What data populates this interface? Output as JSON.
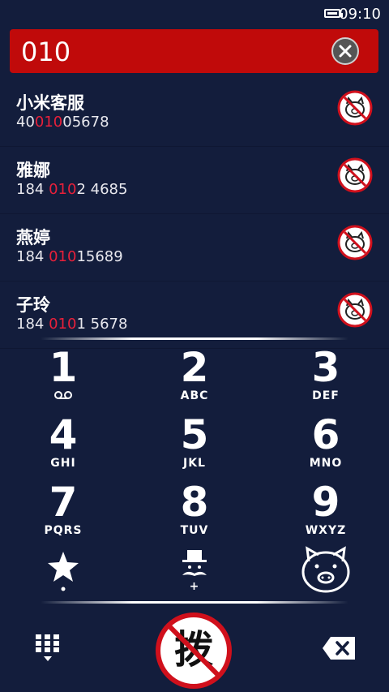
{
  "status_bar": {
    "time": "09:10"
  },
  "search": {
    "value": "010"
  },
  "contacts": [
    {
      "name": "小米客服",
      "number_pre": "40",
      "number_match": "010",
      "number_post": "05678"
    },
    {
      "name": "雅娜",
      "number_pre": "184 ",
      "number_match": "010",
      "number_post": "2 4685"
    },
    {
      "name": "燕婷",
      "number_pre": "184 ",
      "number_match": "010",
      "number_post": "15689"
    },
    {
      "name": "子玲",
      "number_pre": "184 ",
      "number_match": "010",
      "number_post": "1 5678"
    }
  ],
  "keypad": {
    "k1": {
      "digit": "1",
      "letters": ""
    },
    "k2": {
      "digit": "2",
      "letters": "ABC"
    },
    "k3": {
      "digit": "3",
      "letters": "DEF"
    },
    "k4": {
      "digit": "4",
      "letters": "GHI"
    },
    "k5": {
      "digit": "5",
      "letters": "JKL"
    },
    "k6": {
      "digit": "6",
      "letters": "MNO"
    },
    "k7": {
      "digit": "7",
      "letters": "PQRS"
    },
    "k8": {
      "digit": "8",
      "letters": "TUV"
    },
    "k9": {
      "digit": "9",
      "letters": "WXYZ"
    },
    "k0": {
      "digit": "",
      "letters": "+"
    }
  },
  "call_button": {
    "label": "拨"
  },
  "colors": {
    "background": "#131d3c",
    "search_bar": "#c00a0a",
    "highlight": "#e8203a"
  }
}
